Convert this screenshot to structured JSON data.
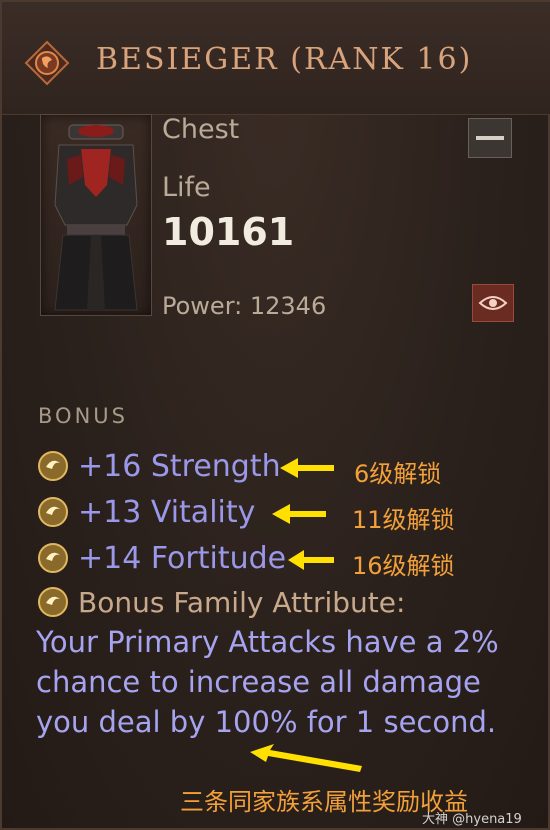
{
  "item": {
    "title": "BESIEGER (RANK 16)",
    "slot": "Chest",
    "stat_label": "Life",
    "stat_value": "10161",
    "power_label": "Power:",
    "power_value": "12346"
  },
  "bonus": {
    "heading": "BONUS",
    "affixes": [
      {
        "text": "+16 Strength",
        "note": "6级解锁"
      },
      {
        "text": "+13 Vitality",
        "note": "11级解锁"
      },
      {
        "text": "+14 Fortitude",
        "note": "16级解锁"
      }
    ],
    "family_label": "Bonus Family Attribute:",
    "family_description": "Your Primary Attacks have a 2% chance to increase all damage you deal by 100% for 1 second.",
    "family_note": "三条同家族系属性奖励收益"
  },
  "icons": {
    "title": "rank-emblem-icon",
    "item": "chest-armor-icon",
    "compare": "minus-icon",
    "inspect": "eye-icon",
    "affix": "gem-orb-icon",
    "arrow": "arrow-left-icon"
  },
  "colors": {
    "title": "#d9a37c",
    "affix": "#9a98e8",
    "annotation": "#f2a03a",
    "arrow": "#ffe000"
  },
  "watermark": "大神 @hyena19"
}
